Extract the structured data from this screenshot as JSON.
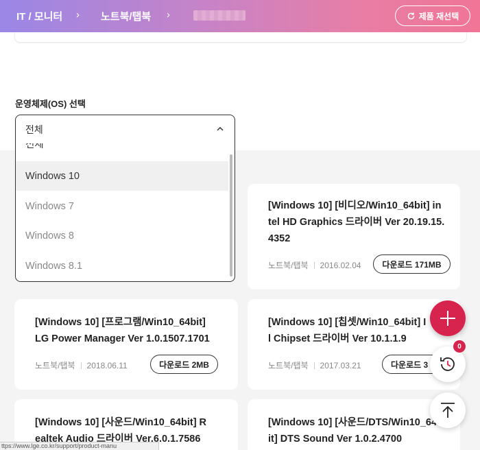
{
  "header": {
    "breadcrumb": [
      "IT / 모니터",
      "노트북/탭북"
    ],
    "reselect_label": "제품 재선택"
  },
  "filter": {
    "os_label": "운영체제(OS) 선택",
    "selected": "전체",
    "options": [
      "전체",
      "Windows 10",
      "Windows 7",
      "Windows 8",
      "Windows 8.1"
    ],
    "highlighted": "Windows 10"
  },
  "cards": [
    {
      "title_lines": [
        "[Windows 10] [비디오/Win10_64bit] in",
        "tel HD Graphics 드라이버 Ver 20.19.15.",
        "4352"
      ],
      "category": "노트북/탭북",
      "date": "2016.02.04",
      "download_label": "다운로드 171MB"
    },
    {
      "title_lines": [
        "[Windows 10] [프로그램/Win10_64bit]",
        "LG Power Manager Ver 1.0.1507.1701"
      ],
      "category": "노트북/탭북",
      "date": "2018.06.11",
      "download_label": "다운로드 2MB"
    },
    {
      "title_lines": [
        "[Windows 10] [칩셋/Win10_64bit] I",
        "l Chipset 드라이버 Ver 10.1.1.9"
      ],
      "category": "노트북/탭북",
      "date": "2017.03.21",
      "download_label": "다운로드 3"
    },
    {
      "title_lines": [
        "[Windows 10] [사운드/Win10_64bit] R",
        "ealtek Audio 드라이버 Ver.6.0.1.7586"
      ]
    },
    {
      "title_lines": [
        "[Windows 10] [사운드/DTS/Win10_64",
        "it] DTS Sound Ver 1.0.2.4700"
      ]
    }
  ],
  "floating": {
    "history_count": "0"
  },
  "status_url": "ttps://www.lge.co.kr/support/product-manu"
}
